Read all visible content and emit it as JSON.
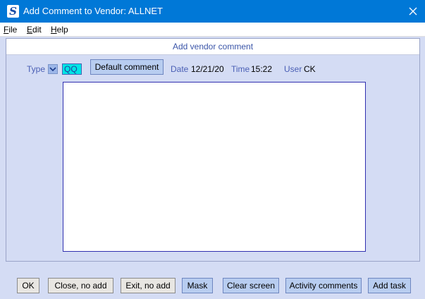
{
  "window": {
    "title": "Add Comment to Vendor:  ALLNET",
    "app_icon_letter": "S"
  },
  "menu": {
    "file": "File",
    "edit": "Edit",
    "help": "Help"
  },
  "panel": {
    "header": "Add vendor comment"
  },
  "fields": {
    "type_label": "Type",
    "type_value": "QQ",
    "default_comment_label": "Default comment",
    "date_label": "Date",
    "date_value": "12/21/20",
    "time_label": "Time",
    "time_value": "15:22",
    "user_label": "User",
    "user_value": "CK",
    "comment_text": ""
  },
  "buttons": {
    "ok": "OK",
    "close_no_add": "Close, no add",
    "exit_no_add": "Exit, no add",
    "mask": "Mask",
    "clear_screen": "Clear screen",
    "activity_comments": "Activity comments",
    "add_task": "Add task"
  },
  "colors": {
    "titlebar": "#0078d7",
    "background": "#d4dcf4",
    "label": "#4a5fb5",
    "type_code_bg": "#00e5e5",
    "button": "#b8cdf0"
  }
}
